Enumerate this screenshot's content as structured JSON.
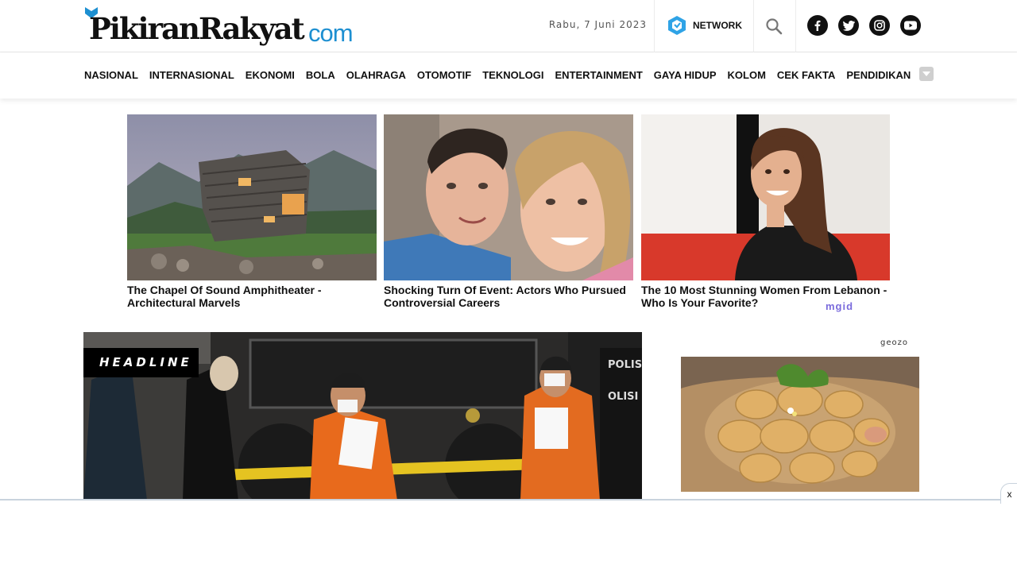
{
  "site": {
    "logo_text": "PikiranRakyat",
    "logo_suffix": "com",
    "date": "Rabu, 7 Juni 2023",
    "network_label": "NETWORK"
  },
  "socials": [
    {
      "icon": "facebook-icon"
    },
    {
      "icon": "twitter-icon"
    },
    {
      "icon": "instagram-icon"
    },
    {
      "icon": "youtube-icon"
    }
  ],
  "nav": {
    "items": [
      "NASIONAL",
      "INTERNASIONAL",
      "EKONOMI",
      "BOLA",
      "OLAHRAGA",
      "OTOMOTIF",
      "TEKNOLOGI",
      "ENTERTAINMENT",
      "GAYA HIDUP",
      "KOLOM",
      "CEK FAKTA",
      "PENDIDIKAN"
    ]
  },
  "ads": [
    {
      "title": "The Chapel Of Sound Amphitheater - Architectural Marvels"
    },
    {
      "title": "Shocking Turn Of Event: Actors Who Pursued Controversial Careers"
    },
    {
      "title": "The 10 Most Stunning Women From Lebanon - Who Is Your Favorite?"
    }
  ],
  "ad_network": "mgid",
  "headline": {
    "tag": "HEADLINE"
  },
  "sidebar_ad": {
    "brand": "geozo"
  },
  "sticky": {
    "close_label": "x"
  },
  "colors": {
    "brand_blue": "#1d8fd1",
    "text": "#111111",
    "headline_tag_bg": "#000000"
  }
}
